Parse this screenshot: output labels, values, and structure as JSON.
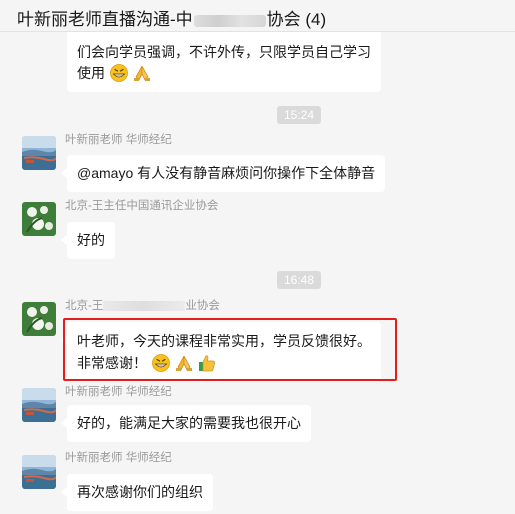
{
  "header": {
    "title_left": "叶新丽老师直播沟通-中",
    "title_right": "协会 (4)"
  },
  "timestamps": [
    "15:24",
    "16:48"
  ],
  "messages": [
    {
      "text_line1": "们会向学员强调，不许外传，只限学员自己学习",
      "text_line2": "使用"
    },
    {
      "sender": "叶新丽老师 华师经纪",
      "text": "@amayo 有人没有静音麻烦问你操作下全体静音"
    },
    {
      "sender": "北京-王主任中国通讯企业协会",
      "text": "好的"
    },
    {
      "sender_left": "北京-王",
      "sender_right": "业协会",
      "text_line1": "叶老师，今天的课程非常实用，学员反馈很好。",
      "text_line2": "非常感谢！"
    },
    {
      "sender": "叶新丽老师 华师经纪",
      "text": "好的，能满足大家的需要我也很开心"
    },
    {
      "sender": "叶新丽老师 华师经纪",
      "text": "再次感谢你们的组织"
    }
  ],
  "colors": {
    "highlight": "#e31d1d",
    "bubble": "#ffffff",
    "background": "#f5f5f5"
  },
  "icons": [
    "grin-emoji",
    "praying-hands-emoji",
    "thumbs-up-emoji"
  ]
}
